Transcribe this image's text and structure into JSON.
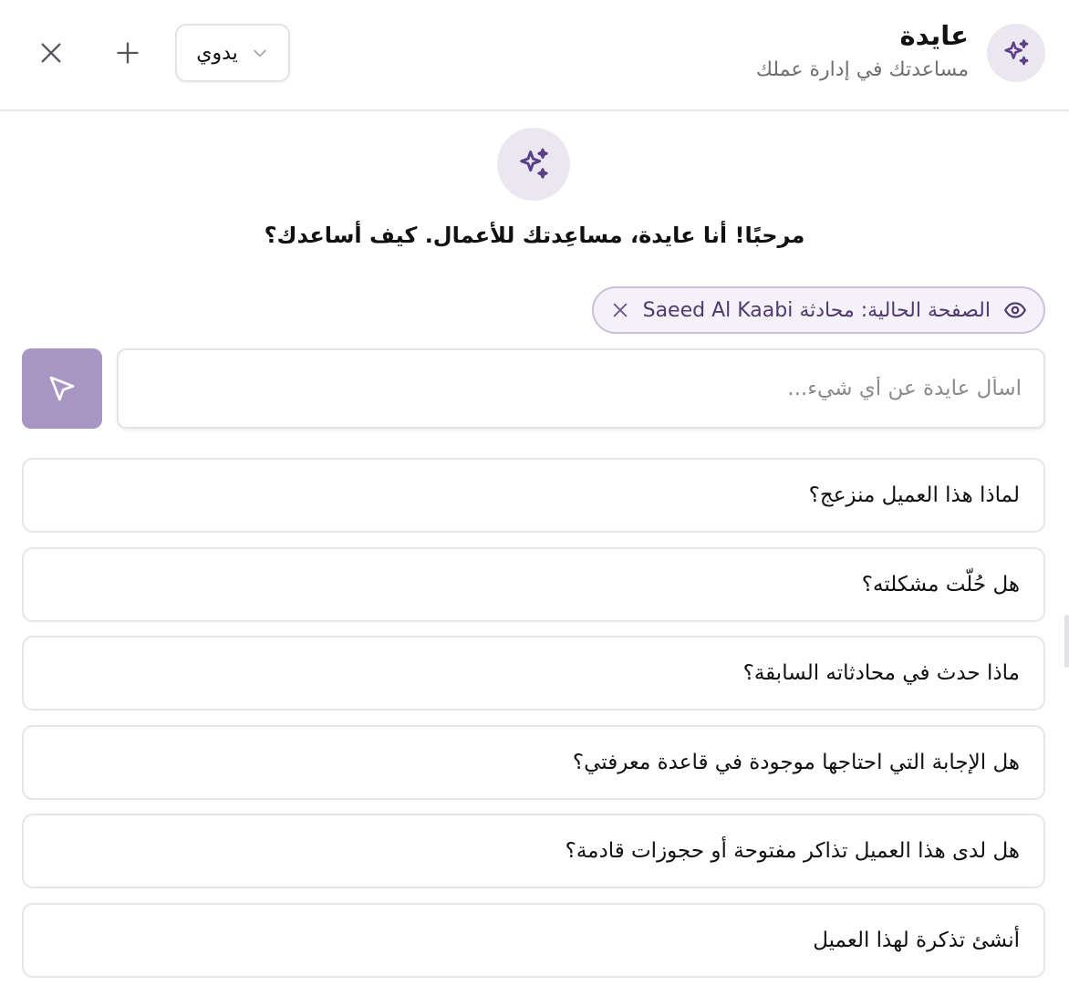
{
  "header": {
    "title": "عايدة",
    "subtitle": "مساعدتك في إدارة عملك",
    "mode_select_value": "يدوي",
    "avatar_icon": "sparkles-icon",
    "close_icon": "close-icon",
    "new_icon": "plus-icon"
  },
  "welcome": {
    "icon": "sparkles-icon",
    "message": "مرحبًا! أنا عايدة، مساعِدتك للأعمال. كيف أساعدك؟"
  },
  "context_chip": {
    "label": "الصفحة الحالية: محادثة Saeed Al Kaabi",
    "eye_icon": "eye-icon",
    "remove_icon": "close-icon"
  },
  "input": {
    "placeholder": "اسأل عايدة عن أي شيء...",
    "value": "",
    "send_icon": "send-icon"
  },
  "suggestions": [
    "لماذا هذا العميل منزعج؟",
    "هل حُلّت مشكلته؟",
    "ماذا حدث في محادثاته السابقة؟",
    "هل الإجابة التي احتاجها موجودة في قاعدة معرفتي؟",
    "هل لدى هذا العميل تذاكر مفتوحة أو حجوزات قادمة؟",
    "أنشئ تذكرة لهذا العميل"
  ],
  "colors": {
    "accent": "#5b3f87",
    "accent_soft": "#ebe7f1",
    "send_button": "#a796c4",
    "chip_border": "#cbbfdb"
  }
}
